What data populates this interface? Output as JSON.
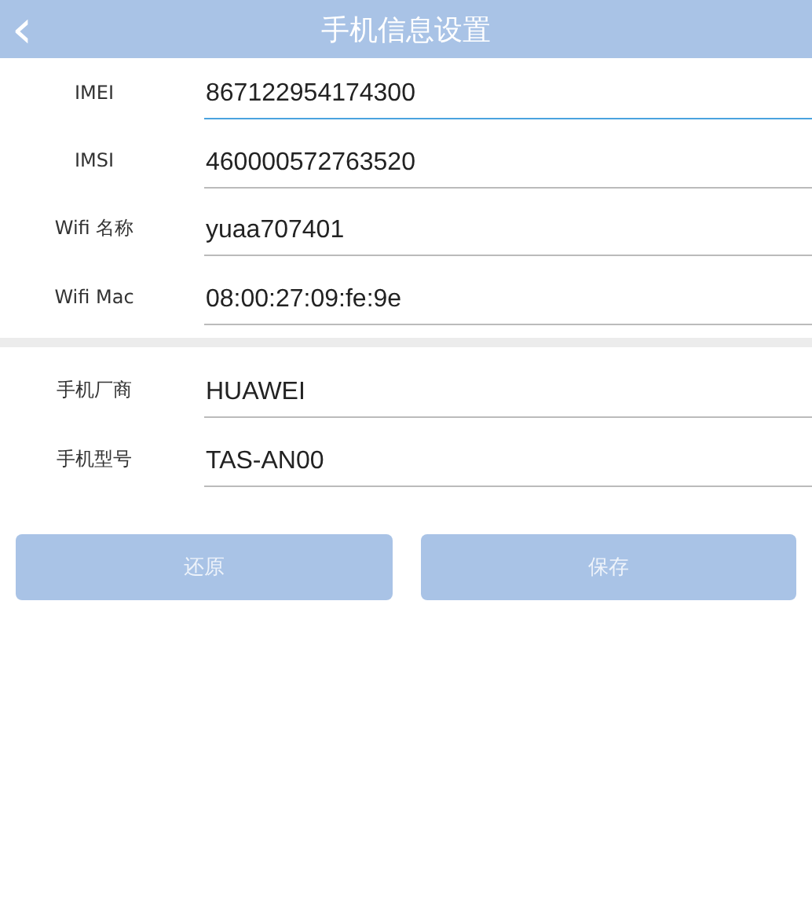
{
  "header": {
    "title": "手机信息设置",
    "back": "‹"
  },
  "sections": [
    {
      "fields": [
        {
          "label": "IMEI",
          "value": "867122954174300",
          "focused": true
        },
        {
          "label": "IMSI",
          "value": "460000572763520",
          "focused": false
        },
        {
          "label": "Wifi 名称",
          "value": "yuaa707401",
          "focused": false
        },
        {
          "label": "Wifi Mac",
          "value": "08:00:27:09:fe:9e",
          "focused": false
        }
      ]
    },
    {
      "fields": [
        {
          "label": "手机厂商",
          "value": "HUAWEI",
          "focused": false
        },
        {
          "label": "手机型号",
          "value": "TAS-AN00",
          "focused": false
        }
      ]
    }
  ],
  "buttons": [
    "还原",
    "保存"
  ]
}
